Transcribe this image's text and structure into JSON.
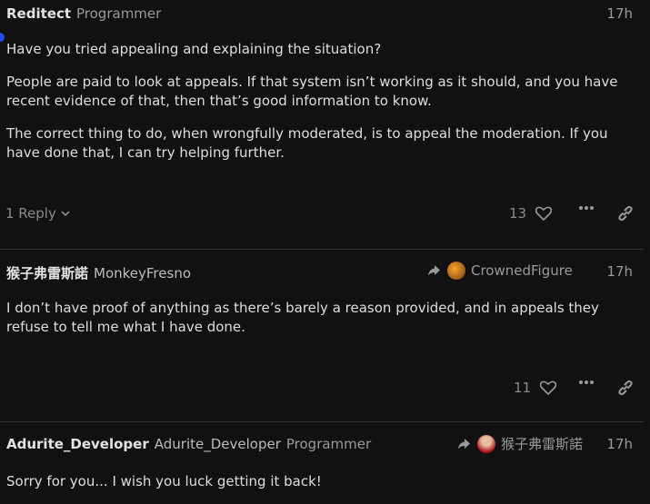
{
  "colors": {
    "background": "#111111",
    "text": "#dedede",
    "muted": "#9a9a9a",
    "accent_dot": "#1a4dff",
    "divider": "#333333"
  },
  "posts": [
    {
      "username": "Reditect",
      "title": "Programmer",
      "time": "17h",
      "paragraphs": [
        "Have you tried appealing and explaining the situation?",
        "People are paid to look at appeals. If that system isn’t working as it should, and you have recent evidence of that, then that’s good information to know.",
        "The correct thing to do, when wrongfully moderated, is to appeal the moderation. If you have done that, I can try helping further."
      ],
      "replies_label": "1 Reply",
      "likes": "13"
    },
    {
      "username": "猴子弗雷斯諾",
      "display_name": "MonkeyFresno",
      "reply_to": "CrownedFigure",
      "time": "17h",
      "paragraphs": [
        "I don’t have proof of anything as there’s barely a reason provided, and in appeals they refuse to tell me what I have done."
      ],
      "likes": "11"
    },
    {
      "username": "Adurite_Developer",
      "display_name": "Adurite_Developer",
      "title": "Programmer",
      "reply_to": "猴子弗雷斯諾",
      "time": "17h",
      "paragraphs": [
        "Sorry for you... I wish you luck getting it back!"
      ]
    }
  ]
}
